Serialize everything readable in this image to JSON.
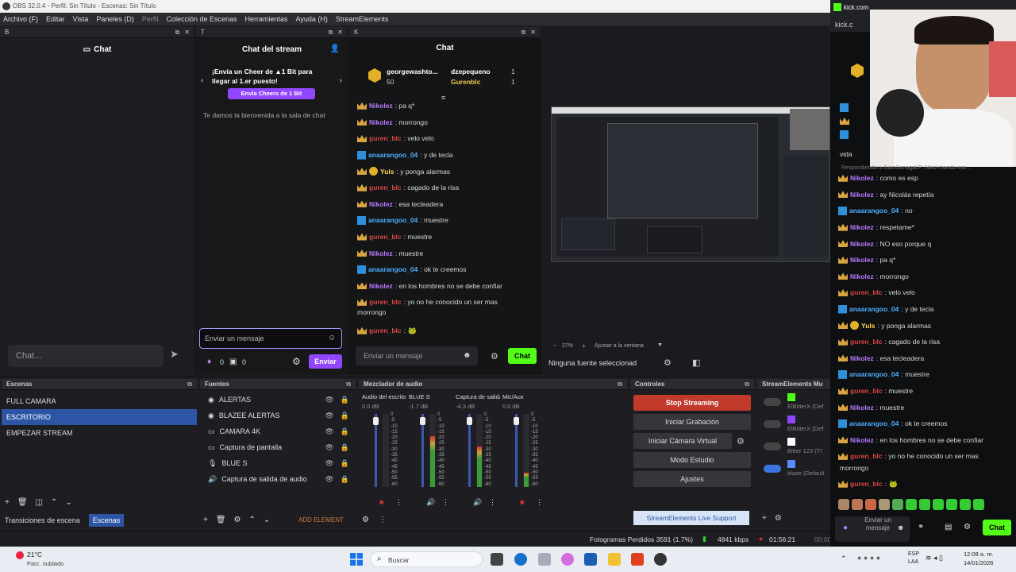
{
  "window": {
    "title": "OBS 32.0.4 - Perfil: Sin Título - Escenas: Sin Título"
  },
  "menu": [
    "Archivo (F)",
    "Editar",
    "Vista",
    "Paneles (D)",
    "Perfil",
    "Colección de Escenas",
    "Herramientas",
    "Ayuda (H)",
    "StreamElements"
  ],
  "dock_b": {
    "letter": "B",
    "title": "Chat",
    "input_placeholder": "Chat..."
  },
  "dock_t": {
    "letter": "T",
    "title": "Chat del stream",
    "cheer_line1": "¡Envía un Cheer de ▲1 Bit para",
    "cheer_line2": "llegar al 1.er puesto!",
    "cheer_button": "Envía Cheers de 1 Bit",
    "welcome": "Te damos la bienvenida a la sala de chat",
    "input_placeholder": "Enviar un mensaje",
    "bits": "0",
    "points": "0",
    "send": "Enviar"
  },
  "dock_k": {
    "letter": "K",
    "title": "Chat",
    "leader1_name": "georgewashto...",
    "leader1_value": "50",
    "leader2_name": "dzepequeno",
    "leader2_value": "1",
    "leader3_name": "Gurenblc",
    "leader3_value": "1",
    "input_placeholder": "Enviar un mensaje",
    "send": "Chat"
  },
  "chat_messages": [
    {
      "user": "Nikolez",
      "color": "purple",
      "badge": "crown",
      "text": ": pa q*"
    },
    {
      "user": "Nikolez",
      "color": "purple",
      "badge": "crown",
      "text": ": morrongo"
    },
    {
      "user": "guren_blc",
      "color": "red",
      "badge": "crown",
      "text": ": velo velo"
    },
    {
      "user": "anaarangoo_04",
      "color": "blue",
      "badge": "kick",
      "text": ": y de tecla"
    },
    {
      "user": "Yuls",
      "color": "yellow",
      "badge": "crown",
      "text": ": y ponga alarmas"
    },
    {
      "user": "guren_blc",
      "color": "red",
      "badge": "crown",
      "text": ": cagado de la risa"
    },
    {
      "user": "Nikolez",
      "color": "purple",
      "badge": "crown",
      "text": ": esa tecleadera"
    },
    {
      "user": "anaarangoo_04",
      "color": "blue",
      "badge": "kick",
      "text": ": muestre"
    },
    {
      "user": "guren_blc",
      "color": "red",
      "badge": "crown",
      "text": ": muestre"
    },
    {
      "user": "Nikolez",
      "color": "purple",
      "badge": "crown",
      "text": ": muestre"
    },
    {
      "user": "anaarangoo_04",
      "color": "blue",
      "badge": "kick",
      "text": ": ok te creemos"
    },
    {
      "user": "Nikolez",
      "color": "purple",
      "badge": "crown",
      "text": ": en los hombres no se debe confiar"
    },
    {
      "user": "guren_blc",
      "color": "red",
      "badge": "crown",
      "text": ": yo no he conocido un ser mas"
    }
  ],
  "chat_wrap_line": "morrongo",
  "last_msg_user": "guren_blc",
  "preview": {
    "zoom": "27%",
    "fit": "Ajustar a la ventana",
    "no_source": "Ninguna fuente seleccionad"
  },
  "scenes": {
    "title": "Escenas",
    "items": [
      "FULL CAMARA",
      "ESCRITORIO",
      "EMPEZAR STREAM"
    ],
    "selected": 1,
    "tab1": "Transiciones de escena",
    "tab2": "Escenas"
  },
  "sources": {
    "title": "Fuentes",
    "items": [
      "ALERTAS",
      "BLAZEE ALERTAS",
      "CAMARA 4K",
      "Captura de pantalla",
      "BLUE S",
      "Captura de salida de audio"
    ],
    "add": "ADD ELEMENT"
  },
  "mixer": {
    "title": "Mezclador de audio",
    "channels": [
      {
        "name": "Audio del escritorio",
        "db": "0.0 dB",
        "level": 0.0
      },
      {
        "name": "BLUE S",
        "db": "-1.7 dB",
        "level": 0.7
      },
      {
        "name": "Captura de salida d",
        "db": "-4.3 dB",
        "level": 0.55
      },
      {
        "name": "Mic/Aux",
        "db": "0.0 dB",
        "level": 0.2
      }
    ],
    "scale": [
      "0",
      "-5",
      "-10",
      "-15",
      "-20",
      "-25",
      "-30",
      "-35",
      "-40",
      "-45",
      "-50",
      "-55",
      "-60"
    ]
  },
  "controls": {
    "title": "Controles",
    "stop": "Stop Streaming",
    "record": "Iniciar Grabación",
    "vcam": "Iniciar Cámara Virtual",
    "studio": "Modo Estudio",
    "settings": "Ajustes",
    "support": "StreamElements Live Support"
  },
  "se_multistream": {
    "title": "StreamElements Mu",
    "rows": [
      "ElBitterX (Def",
      "ElBitterX (Def",
      "Bitter 123 (TI",
      "blaze (Default"
    ]
  },
  "statusbar": {
    "frames": "Fotogramas Perdidos 3591 (1.7%)",
    "kbps": "4841 kbps",
    "time": "01:56:21",
    "time2": "00:00"
  },
  "right_panel": {
    "site": "kick.com",
    "site2": "kick.c",
    "reply": "Respondiendo a JuanJumagaLP: Nikol manda ese...",
    "vida": "vida",
    "messages": [
      {
        "user": "Nikolez",
        "color": "purple",
        "text": ": como es esp"
      },
      {
        "user": "Nikolez",
        "color": "purple",
        "text": ": ay Nicolás repetía"
      },
      {
        "user": "anaarangoo_04",
        "color": "blue",
        "text": ": no"
      },
      {
        "user": "Nikolez",
        "color": "purple",
        "text": ": respetame*"
      },
      {
        "user": "Nikolez",
        "color": "purple",
        "text": ": NO eso porque q"
      },
      {
        "user": "Nikolez",
        "color": "purple",
        "text": ": pa q*"
      },
      {
        "user": "Nikolez",
        "color": "purple",
        "text": ": morrongo"
      },
      {
        "user": "guren_blc",
        "color": "red",
        "text": ": velo velo"
      },
      {
        "user": "anaarangoo_04",
        "color": "blue",
        "text": ": y de tecla"
      },
      {
        "user": "Yuls",
        "color": "yellow",
        "text": ": y ponga alarmas"
      },
      {
        "user": "guren_blc",
        "color": "red",
        "text": ": cagado de la risa"
      },
      {
        "user": "Nikolez",
        "color": "purple",
        "text": ": esa tecleadera"
      },
      {
        "user": "anaarangoo_04",
        "color": "blue",
        "text": ": muestre"
      },
      {
        "user": "guren_blc",
        "color": "red",
        "text": ": muestre"
      },
      {
        "user": "Nikolez",
        "color": "purple",
        "text": ": muestre"
      },
      {
        "user": "anaarangoo_04",
        "color": "blue",
        "text": ": ok te creemos"
      },
      {
        "user": "Nikolez",
        "color": "purple",
        "text": ": en los hombres no se debe confiar"
      },
      {
        "user": "guren_blc",
        "color": "red",
        "text": ": yo no he conocido un ser mas"
      }
    ],
    "wrap": "morrongo",
    "last_user": "guren_blc",
    "input_placeholder": "Enviar un mensaje",
    "send": "Chat"
  },
  "taskbar": {
    "temp": "21°C",
    "weather": "Parc. nublado",
    "search": "Buscar",
    "lang1": "ESP",
    "lang2": "LAA",
    "clock": "12:08 a. m.",
    "date": "14/01/2026"
  }
}
